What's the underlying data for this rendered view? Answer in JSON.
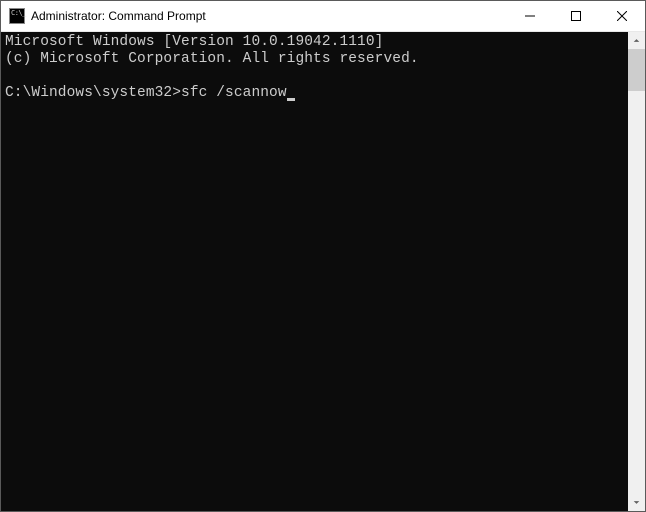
{
  "window": {
    "title": "Administrator: Command Prompt"
  },
  "terminal": {
    "line1": "Microsoft Windows [Version 10.0.19042.1110]",
    "line2": "(c) Microsoft Corporation. All rights reserved.",
    "blank": "",
    "prompt": "C:\\Windows\\system32>",
    "command": "sfc /scannow"
  },
  "colors": {
    "terminal_bg": "#0c0c0c",
    "terminal_fg": "#cccccc"
  }
}
